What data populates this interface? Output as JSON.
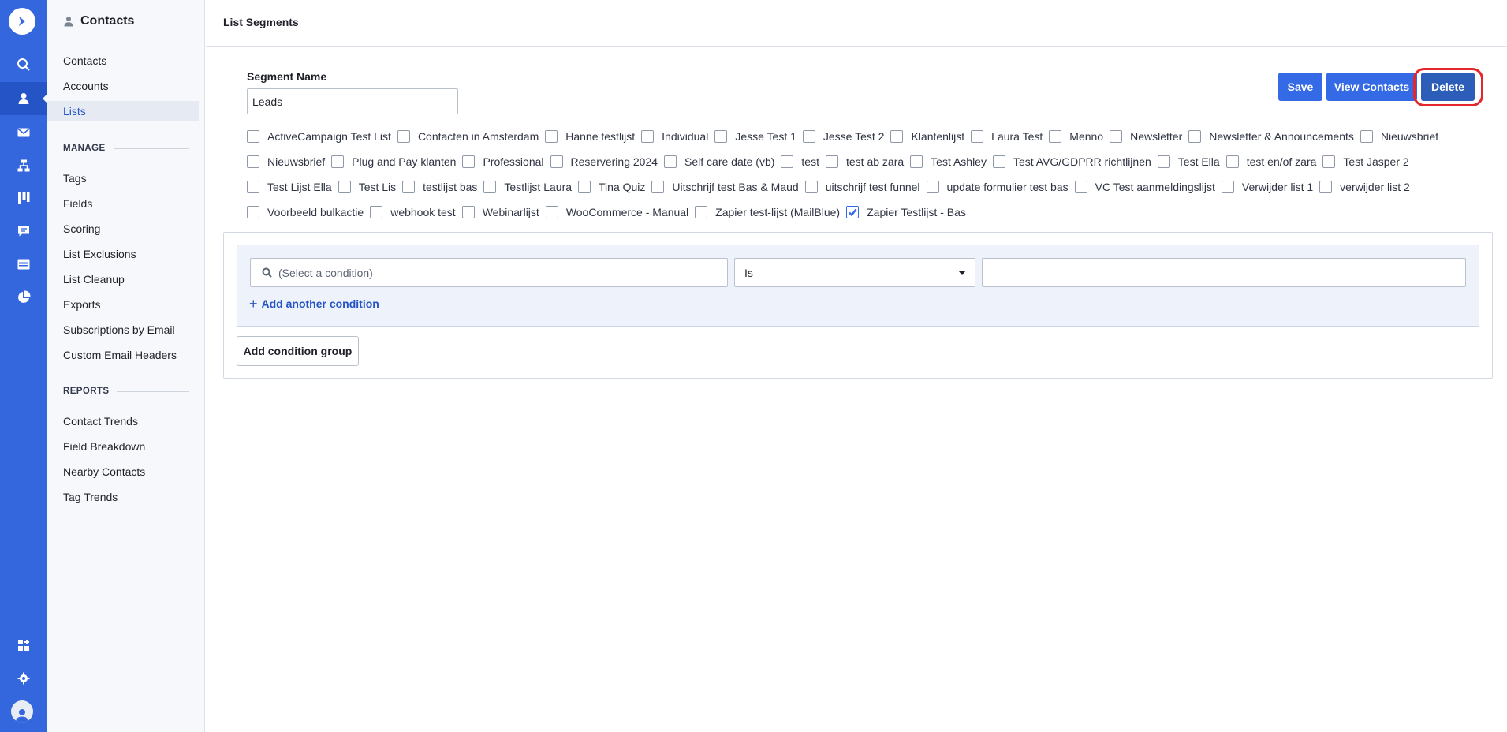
{
  "rail": {
    "items": [
      "logo-icon",
      "search-icon",
      "contacts-icon",
      "mail-icon",
      "automations-icon",
      "deals-icon",
      "conversations-icon",
      "website-icon",
      "reports-icon",
      "apps-icon",
      "settings-icon",
      "avatar-icon"
    ],
    "accent": "#3467de"
  },
  "sidebar": {
    "title": "Contacts",
    "items": [
      "Contacts",
      "Accounts",
      "Lists"
    ],
    "active": "Lists",
    "manage_heading": "MANAGE",
    "manage": [
      "Tags",
      "Fields",
      "Scoring",
      "List Exclusions",
      "List Cleanup",
      "Exports",
      "Subscriptions by Email",
      "Custom Email Headers"
    ],
    "reports_heading": "REPORTS",
    "reports": [
      "Contact Trends",
      "Field Breakdown",
      "Nearby Contacts",
      "Tag Trends"
    ]
  },
  "header": {
    "title": "List Segments"
  },
  "segment": {
    "label": "Segment Name",
    "value": "Leads"
  },
  "actions": {
    "save": "Save",
    "view_contacts": "View Contacts",
    "delete": "Delete"
  },
  "lists": {
    "row1": [
      {
        "label": "ActiveCampaign Test List",
        "checked": false
      },
      {
        "label": "Contacten in Amsterdam",
        "checked": false
      },
      {
        "label": "Hanne testlijst",
        "checked": false
      },
      {
        "label": "Individual",
        "checked": false
      },
      {
        "label": "Jesse Test 1",
        "checked": false
      },
      {
        "label": "Jesse Test 2",
        "checked": false
      },
      {
        "label": "Klantenlijst",
        "checked": false
      },
      {
        "label": "Laura Test",
        "checked": false
      },
      {
        "label": "Menno",
        "checked": false
      },
      {
        "label": "Newsletter",
        "checked": false
      },
      {
        "label": "Newsletter & Announcements",
        "checked": false
      },
      {
        "label": "Nieuwsbrief",
        "checked": false
      }
    ],
    "row2": [
      {
        "label": "Nieuwsbrief",
        "checked": false
      },
      {
        "label": "Plug and Pay klanten",
        "checked": false
      },
      {
        "label": "Professional",
        "checked": false
      },
      {
        "label": "Reservering 2024",
        "checked": false
      },
      {
        "label": "Self care date (vb)",
        "checked": false
      },
      {
        "label": "test",
        "checked": false
      },
      {
        "label": "test ab zara",
        "checked": false
      },
      {
        "label": "Test Ashley",
        "checked": false
      },
      {
        "label": "Test AVG/GDPRR richtlijnen",
        "checked": false
      },
      {
        "label": "Test Ella",
        "checked": false
      },
      {
        "label": "test en/of zara",
        "checked": false
      },
      {
        "label": "Test Jasper 2",
        "checked": false
      }
    ],
    "row3": [
      {
        "label": "Test Lijst Ella",
        "checked": false
      },
      {
        "label": "Test Lis",
        "checked": false
      },
      {
        "label": "testlijst bas",
        "checked": false
      },
      {
        "label": "Testlijst Laura",
        "checked": false
      },
      {
        "label": "Tina Quiz",
        "checked": false
      },
      {
        "label": "Uitschrijf test Bas & Maud",
        "checked": false
      },
      {
        "label": "uitschrijf test funnel",
        "checked": false
      },
      {
        "label": "update formulier test bas",
        "checked": false
      },
      {
        "label": "VC Test aanmeldingslijst",
        "checked": false
      },
      {
        "label": "Verwijder list 1",
        "checked": false
      },
      {
        "label": "verwijder list 2",
        "checked": false
      }
    ],
    "row4": [
      {
        "label": "Voorbeeld bulkactie",
        "checked": false
      },
      {
        "label": "webhook test",
        "checked": false
      },
      {
        "label": "Webinarlijst",
        "checked": false
      },
      {
        "label": "WooCommerce - Manual",
        "checked": false
      },
      {
        "label": "Zapier test-lijst (MailBlue)",
        "checked": false
      },
      {
        "label": "Zapier Testlijst - Bas",
        "checked": true
      }
    ]
  },
  "conditions": {
    "select_placeholder": "(Select a condition)",
    "operator": "Is",
    "value": "",
    "add_condition": "Add another condition",
    "add_group": "Add condition group"
  },
  "colors": {
    "primary": "#356ae6",
    "delete": "#2c5db8",
    "highlight": "#e4262f"
  }
}
